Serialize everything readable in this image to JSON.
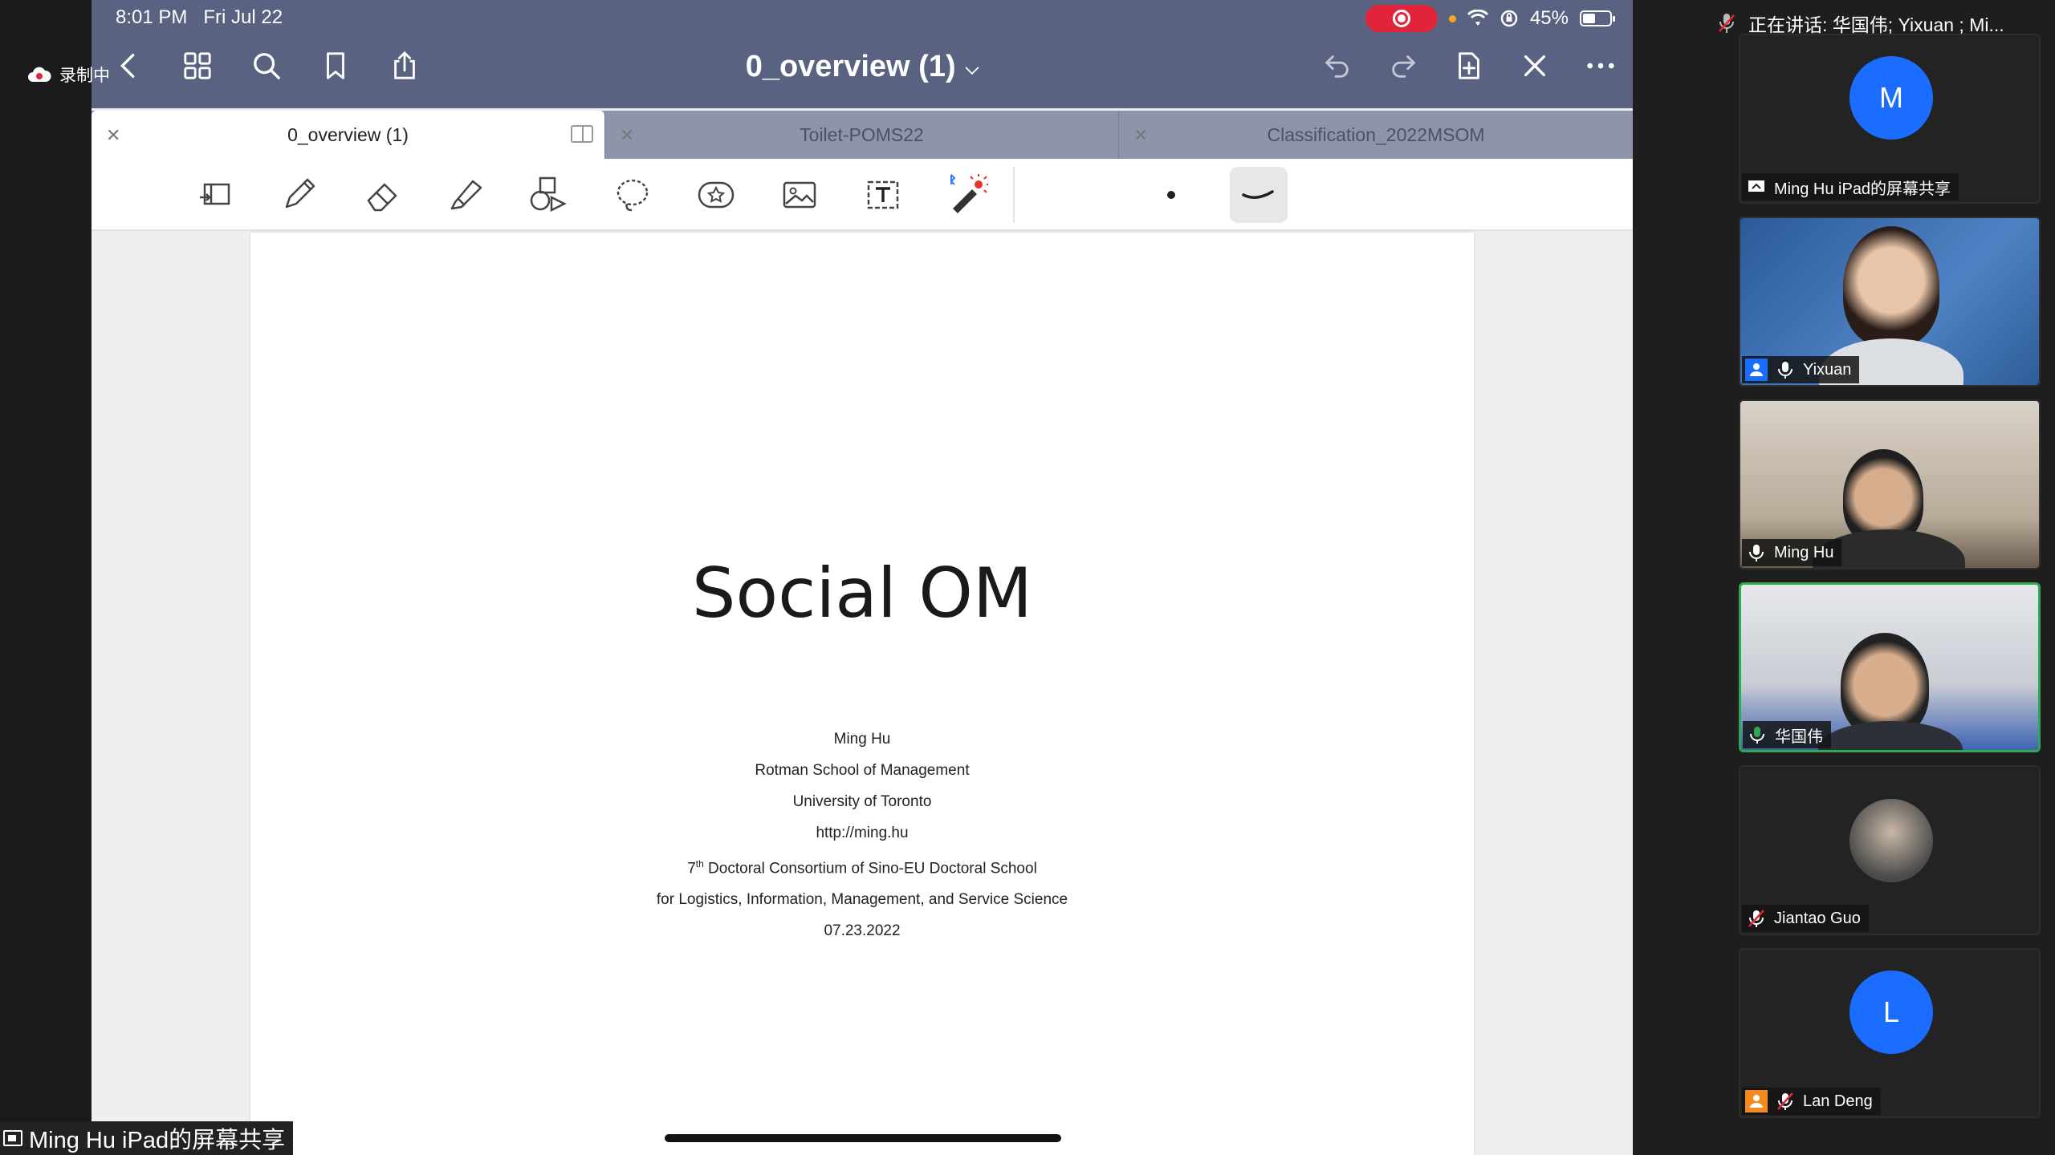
{
  "recording": {
    "label": "录制中"
  },
  "status": {
    "time": "8:01 PM",
    "date": "Fri Jul 22",
    "battery": "45%",
    "battery_level": 0.45
  },
  "document": {
    "title": "0_overview (1)"
  },
  "tabs": [
    {
      "label": "0_overview (1)"
    },
    {
      "label": "Toilet-POMS22"
    },
    {
      "label": "Classification_2022MSOM"
    }
  ],
  "slide": {
    "title": "Social OM",
    "author": "Ming Hu",
    "school": "Rotman School of Management",
    "university": "University of Toronto",
    "url": "http://ming.hu",
    "consortium_num": "7",
    "consortium_sup": "th",
    "consortium_rest": " Doctoral Consortium of Sino-EU Doctoral School",
    "field": "for Logistics, Information, Management, and Service Science",
    "date": "07.23.2022"
  },
  "share_label": "Ming Hu iPad的屏幕共享",
  "speaking": "正在讲话: 华国伟; Yixuan ; Mi...",
  "participants": [
    {
      "initial": "M",
      "name": "Ming Hu iPad的屏幕共享"
    },
    {
      "name": "Yixuan"
    },
    {
      "name": "Ming Hu"
    },
    {
      "name": "华国伟"
    },
    {
      "name": "Jiantao Guo"
    },
    {
      "initial": "L",
      "name": "Lan Deng"
    }
  ],
  "colors": {
    "toolbar": "#5a6282",
    "tabs": "#8e94aa",
    "record_red": "#e0253a",
    "avatar_blue": "#1a6dff",
    "active_speaker": "#2fa84f"
  }
}
